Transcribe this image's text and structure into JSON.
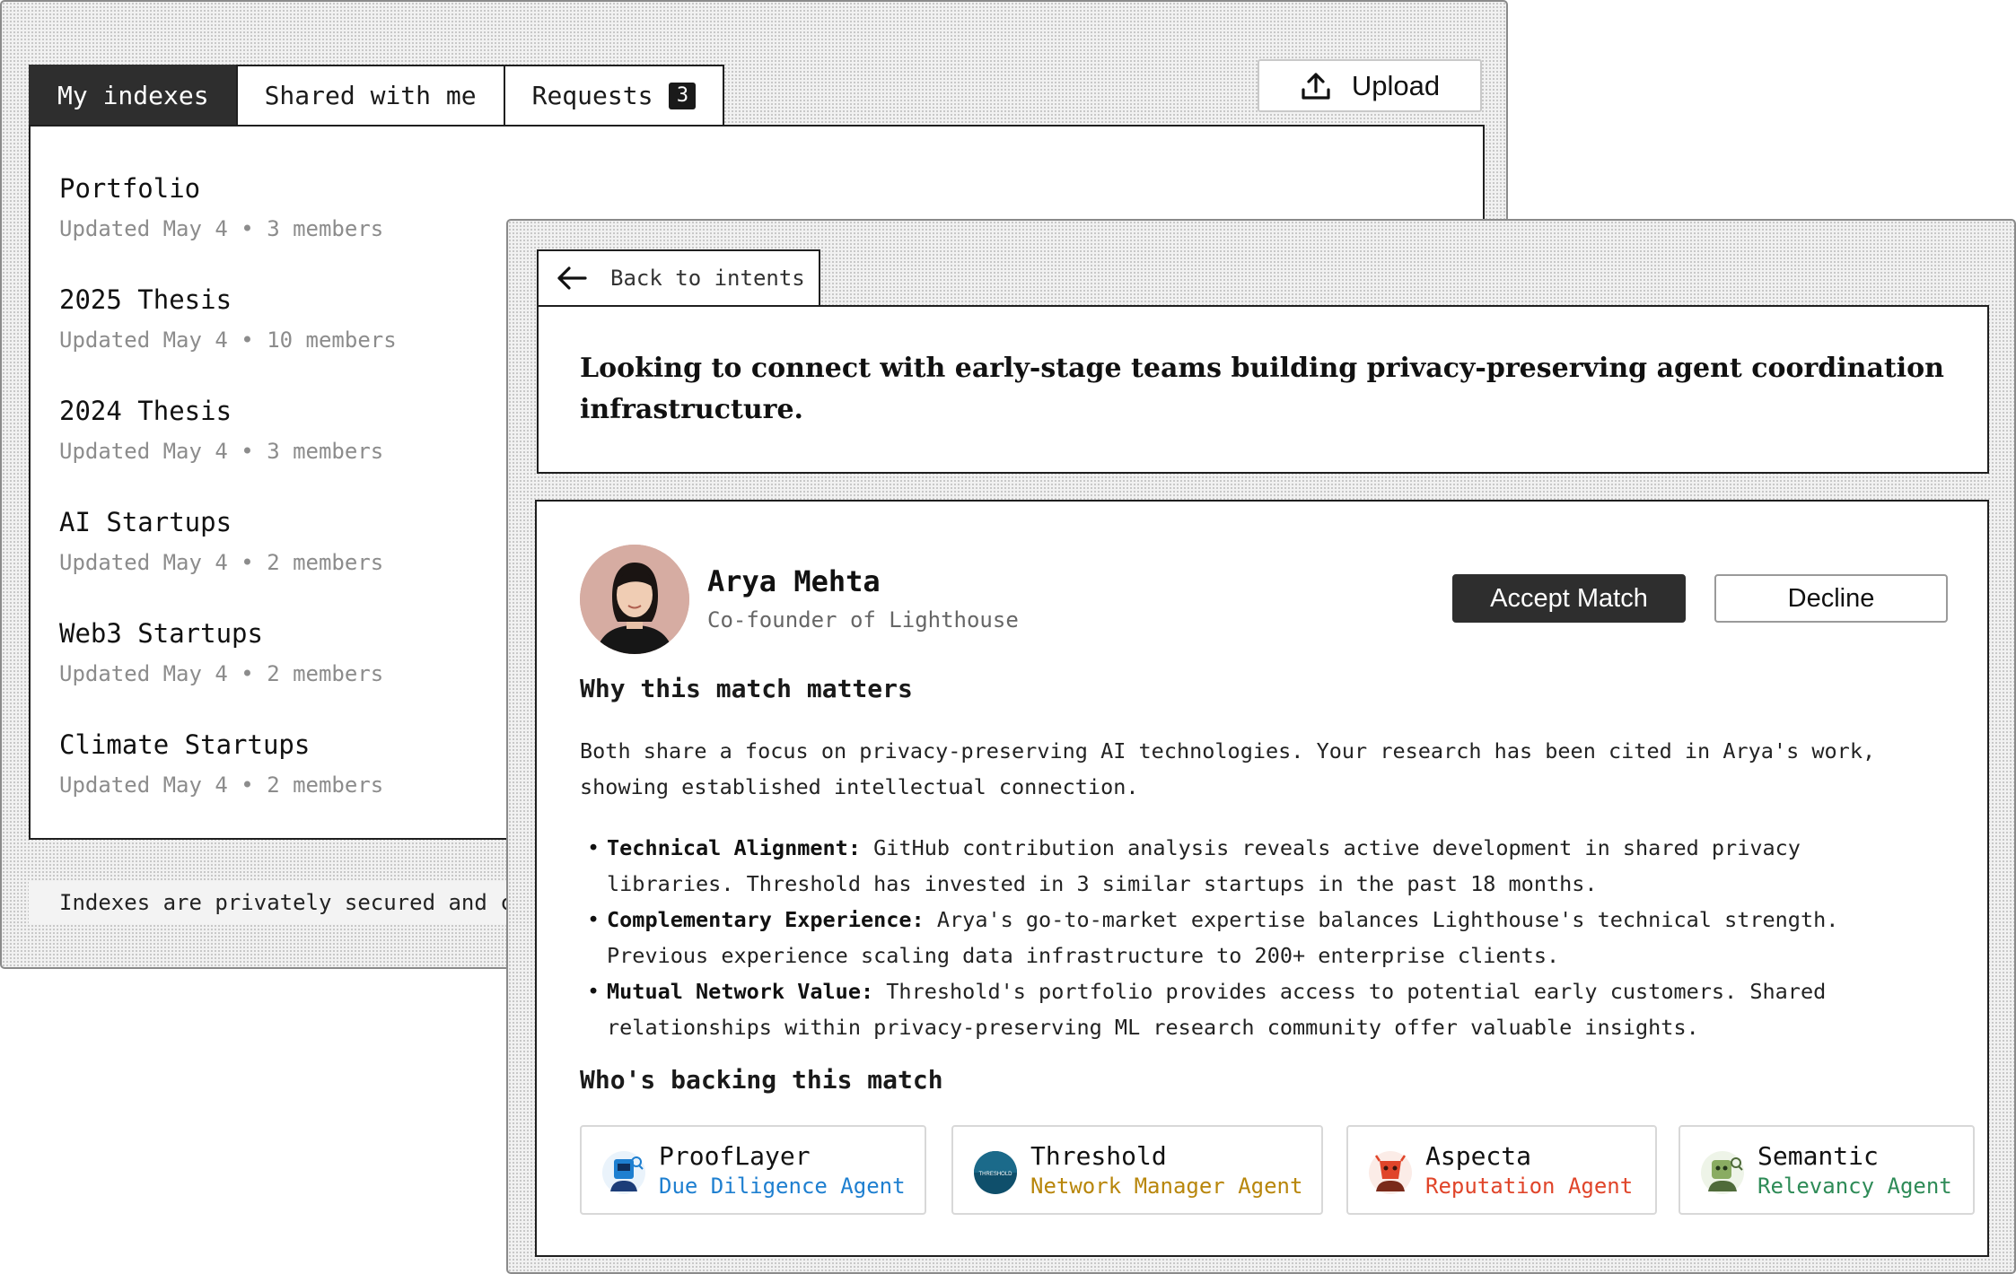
{
  "indexes_window": {
    "tabs": [
      {
        "label": "My indexes",
        "active": true
      },
      {
        "label": "Shared with me",
        "active": false
      },
      {
        "label": "Requests",
        "active": false,
        "badge": "3"
      }
    ],
    "upload_label": "Upload",
    "items": [
      {
        "name": "Portfolio",
        "meta": "Updated May 4 • 3 members"
      },
      {
        "name": "2025 Thesis",
        "meta": "Updated May 4 • 10 members"
      },
      {
        "name": "2024 Thesis",
        "meta": "Updated May 4 • 3 members"
      },
      {
        "name": "AI Startups",
        "meta": "Updated May 4 • 2 members"
      },
      {
        "name": "Web3 Startups",
        "meta": "Updated May 4 • 2 members"
      },
      {
        "name": "Climate Startups",
        "meta": "Updated May 4 • 2 members"
      }
    ],
    "footer_note": "Indexes are privately secured and c"
  },
  "intent_window": {
    "back_label": "Back to intents",
    "intent_text": "Looking to connect with early-stage teams building privacy-preserving agent coordination infrastructure.",
    "match": {
      "name": "Arya Mehta",
      "role": "Co-founder of Lighthouse",
      "accept_label": "Accept Match",
      "decline_label": "Decline",
      "why_title": "Why this match matters",
      "why_body": "Both share a focus on privacy-preserving AI technologies. Your research has been cited in Arya's work, showing established intellectual connection.",
      "reasons": [
        {
          "title": "Technical Alignment:",
          "text": "GitHub contribution analysis reveals active development in shared privacy libraries. Threshold has invested in 3 similar startups in the past 18 months."
        },
        {
          "title": "Complementary Experience:",
          "text": "Arya's go-to-market expertise balances Lighthouse's technical strength. Previous experience scaling data infrastructure to 200+ enterprise clients."
        },
        {
          "title": "Mutual Network Value:",
          "text": "Threshold's portfolio provides access to potential early customers. Shared relationships within privacy-preserving ML research community offer valuable insights."
        }
      ],
      "backing_title": "Who's backing this match",
      "agents": [
        {
          "name": "ProofLayer",
          "role": "Due Diligence Agent",
          "color": "#1e7fd0",
          "icon": "prooflayer-robot-icon"
        },
        {
          "name": "Threshold",
          "role": "Network Manager Agent",
          "color": "#b8860b",
          "icon": "threshold-logo-icon",
          "logo_text": "THRESHOLD"
        },
        {
          "name": "Aspecta",
          "role": "Reputation Agent",
          "color": "#e0452a",
          "icon": "aspecta-robot-icon"
        },
        {
          "name": "Semantic",
          "role": "Relevancy Agent",
          "color": "#2e8b57",
          "icon": "semantic-robot-icon"
        }
      ]
    }
  }
}
